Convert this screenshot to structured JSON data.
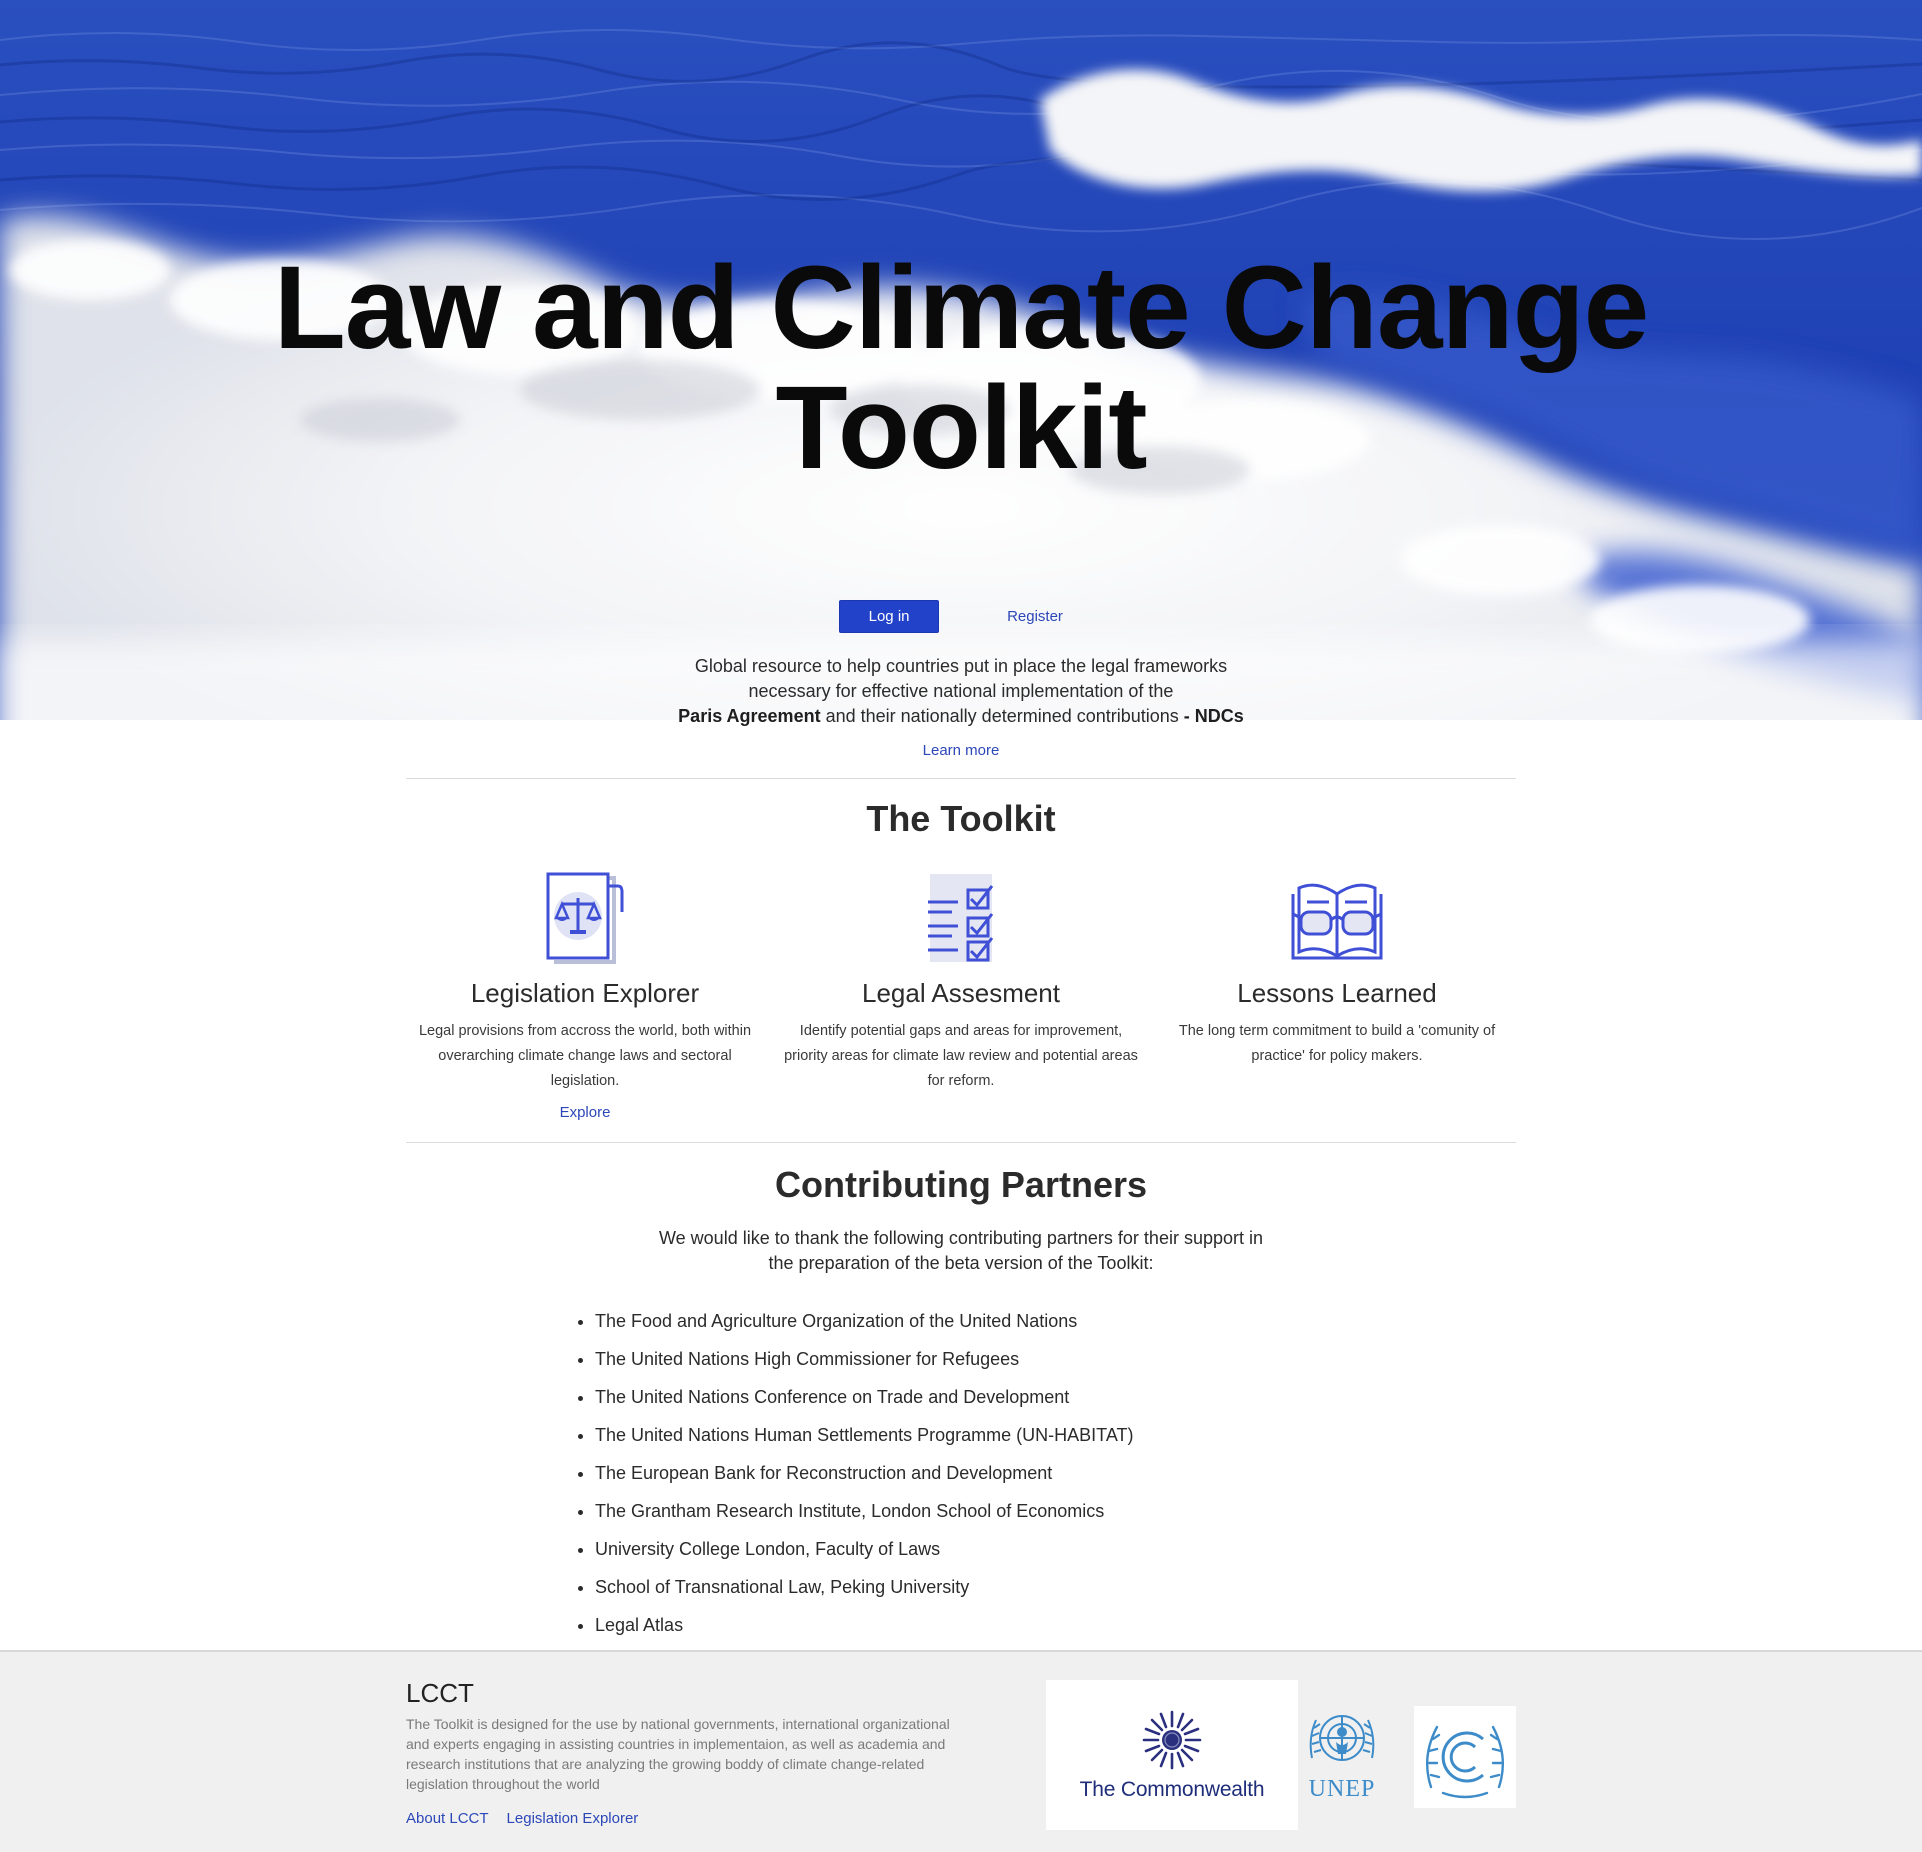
{
  "hero": {
    "title_line1": "Law and Climate Change",
    "title_line2": "Toolkit"
  },
  "auth": {
    "login_label": "Log in",
    "register_label": "Register"
  },
  "intro": {
    "line1": "Global resource to help countries put in place the legal frameworks",
    "line2": "necessary for effective national implementation of the",
    "line3_bold_start": "Paris Agreement",
    "line3_middle": " and their nationally determined contributions ",
    "line3_bold_end": "- NDCs",
    "learn_more": "Learn more"
  },
  "toolkit": {
    "title": "The Toolkit",
    "items": [
      {
        "icon": "legislation-scales-icon",
        "heading": "Legislation Explorer",
        "text": "Legal provisions from accross the world, both within overarching climate change laws and sectoral legislation.",
        "link": "Explore"
      },
      {
        "icon": "checklist-icon",
        "heading": "Legal Assesment",
        "text": "Identify potential gaps and areas for improvement, priority areas for climate law review and potential areas for reform."
      },
      {
        "icon": "book-glasses-icon",
        "heading": "Lessons Learned",
        "text": "The long term commitment to build a 'comunity of practice' for policy makers."
      }
    ]
  },
  "partners": {
    "title": "Contributing Partners",
    "intro_line1": "We would like to thank the following contributing partners for their support in",
    "intro_line2": "the preparation of the beta version of the Toolkit:",
    "items": [
      "The Food and Agriculture Organization of the United Nations",
      "The United Nations High Commissioner for Refugees",
      "The United Nations Conference on Trade and Development",
      "The United Nations Human Settlements Programme (UN-HABITAT)",
      "The European Bank for Reconstruction and Development",
      "The Grantham Research Institute, London School of Economics",
      "University College London, Faculty of Laws",
      "School of Transnational Law, Peking University",
      "Legal Atlas"
    ]
  },
  "footer": {
    "brand": "LCCT",
    "description": "The Toolkit is designed for the use by national governments, international organizational and experts engaging in assisting countries in implementaion, as well as academia and research institutions that are analyzing the growing boddy of climate change-related legislation throughout the world",
    "links": [
      "About LCCT",
      "Legislation Explorer"
    ],
    "logos": {
      "commonwealth": "The Commonwealth",
      "unep": "UNEP"
    }
  },
  "colors": {
    "accent": "#2242c9",
    "link": "#2c47b8",
    "icon_blue": "#3f4fd6",
    "ocean_deep": "#1d3fb0",
    "footer_bg": "#f0f0f0"
  }
}
